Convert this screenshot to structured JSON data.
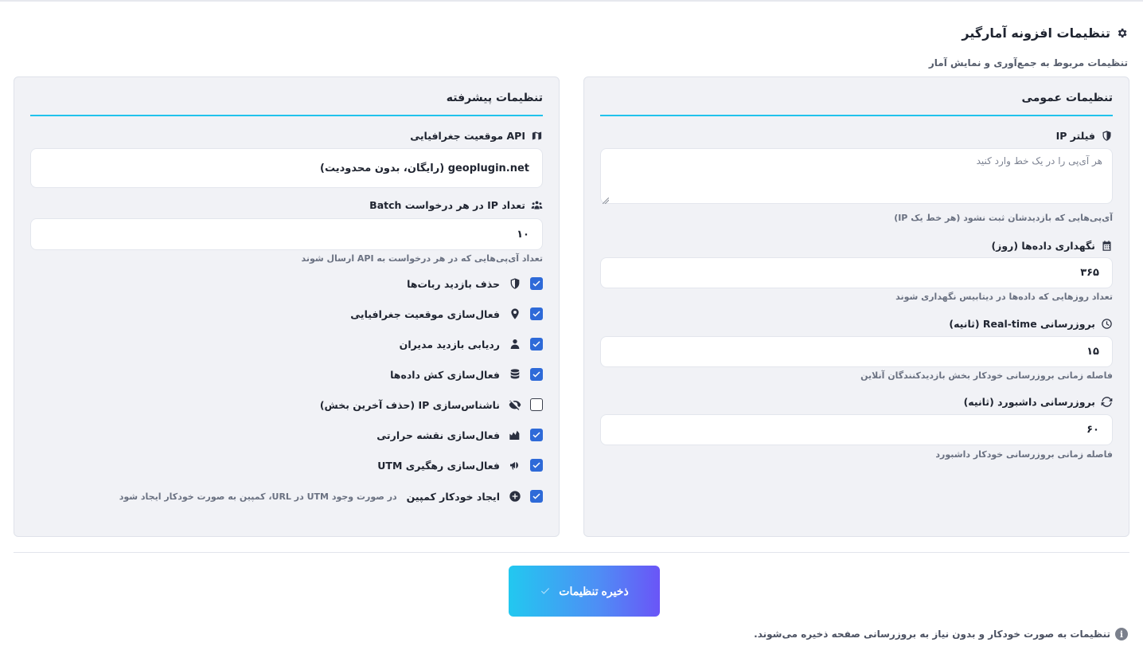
{
  "header": {
    "title": "تنظیمات افزونه آمارگیر",
    "subtitle": "تنظیمات مربوط به جمع‌آوری و نمایش آمار"
  },
  "general": {
    "title": "تنظیمات عمومی",
    "ip_filter": {
      "label": "فیلتر IP",
      "placeholder": "هر آی‌پی را در یک خط وارد کنید",
      "help": "آی‌پی‌هایی که بازدیدشان ثبت نشود (هر خط یک IP)"
    },
    "retention": {
      "label": "نگهداری داده‌ها (روز)",
      "value": "۳۶۵",
      "help": "تعداد روزهایی که داده‌ها در دیتابیس نگهداری شوند"
    },
    "realtime": {
      "label": "بروزرسانی Real-time (ثانیه)",
      "value": "۱۵",
      "help": "فاصله زمانی بروزرسانی خودکار بخش بازدیدکنندگان آنلاین"
    },
    "dashboard": {
      "label": "بروزرسانی داشبورد (ثانیه)",
      "value": "۶۰",
      "help": "فاصله زمانی بروزرسانی خودکار داشبورد"
    }
  },
  "advanced": {
    "title": "تنظیمات پیشرفته",
    "geo_api": {
      "label": "API موقعیت جغرافیایی",
      "value": "geoplugin.net (رایگان، بدون محدودیت)"
    },
    "batch": {
      "label": "تعداد IP در هر درخواست Batch",
      "value": "۱۰",
      "help": "تعداد آی‌پی‌هایی که در هر درخواست به API ارسال شوند"
    },
    "options": [
      {
        "label": "حذف بازدید ربات‌ها",
        "checked": true,
        "icon": "shield-icon"
      },
      {
        "label": "فعال‌سازی موقعیت جغرافیایی",
        "checked": true,
        "icon": "map-marker-icon"
      },
      {
        "label": "ردیابی بازدید مدیران",
        "checked": true,
        "icon": "user-icon"
      },
      {
        "label": "فعال‌سازی کش داده‌ها",
        "checked": true,
        "icon": "database-icon"
      },
      {
        "label": "ناشناس‌سازی IP (حذف آخرین بخش)",
        "checked": false,
        "icon": "eye-slash-icon"
      },
      {
        "label": "فعال‌سازی نقشه حرارتی",
        "checked": true,
        "icon": "heatmap-icon"
      },
      {
        "label": "فعال‌سازی رهگیری UTM",
        "checked": true,
        "icon": "megaphone-icon"
      },
      {
        "label": "ایجاد خودکار کمپین",
        "note": "در صورت وجود UTM در URL، کمپین به صورت خودکار ایجاد شود",
        "checked": true,
        "icon": "plus-circle-icon"
      }
    ]
  },
  "actions": {
    "save_label": "ذخیره تنظیمات"
  },
  "footer": {
    "note": "تنظیمات به صورت خودکار و بدون نیاز به بروزرسانی صفحه ذخیره می‌شوند."
  },
  "colors": {
    "accent": "#21c3ec",
    "checkbox": "#2e6ad8",
    "button_start": "#22c8f0",
    "button_end": "#6a55f7"
  }
}
